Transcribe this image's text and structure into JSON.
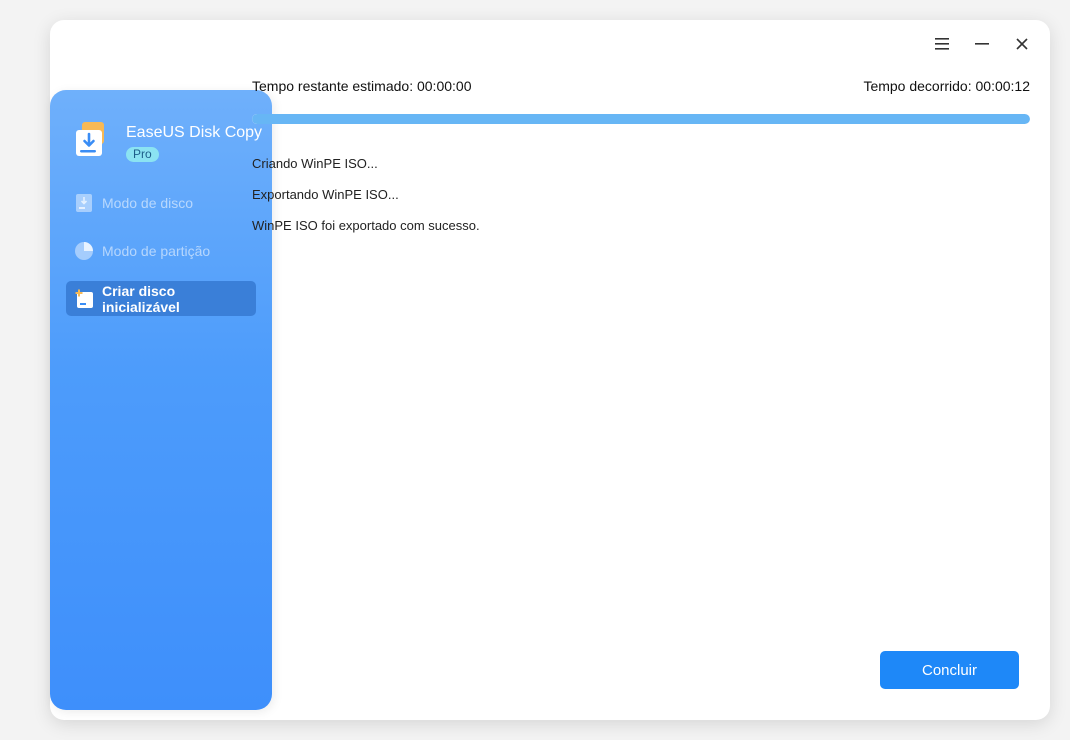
{
  "window": {
    "controls": [
      {
        "name": "menu-icon"
      },
      {
        "name": "minimize-icon"
      },
      {
        "name": "close-icon"
      }
    ]
  },
  "sidebar": {
    "app_name": "EaseUS Disk Copy",
    "edition": "Pro",
    "items": [
      {
        "label": "Modo de disco",
        "icon": "disk-icon",
        "active": false
      },
      {
        "label": "Modo de partição",
        "icon": "partition-icon",
        "active": false
      },
      {
        "label": "Criar disco inicializável",
        "icon": "bootable-disk-icon",
        "active": true
      }
    ]
  },
  "main": {
    "remaining_label": "Tempo restante estimado:",
    "remaining_value": "00:00:00",
    "elapsed_label": "Tempo decorrido:",
    "elapsed_value": "00:00:12",
    "progress": 1.0,
    "log": [
      "Criando WinPE ISO...",
      "Exportando WinPE ISO...",
      "WinPE ISO foi exportado com sucesso."
    ],
    "finish_label": "Concluir"
  },
  "colors": {
    "accent": "#1e88f8",
    "progress": "#67b6f5",
    "sidebar_top": "#6fb0fb",
    "sidebar_bottom": "#3e8ffb"
  }
}
